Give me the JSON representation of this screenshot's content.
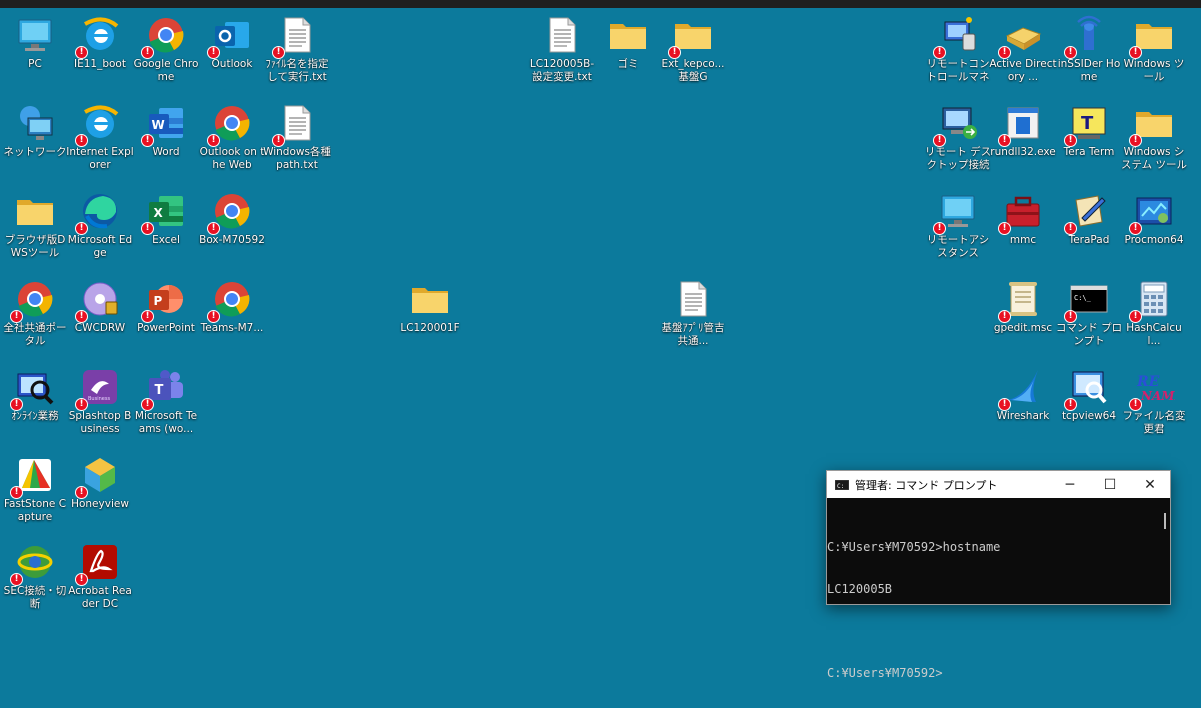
{
  "icons": [
    {
      "label": "PC",
      "kind": "monitor",
      "shortcut": false
    },
    {
      "label": "IE11_boot",
      "kind": "ie",
      "shortcut": true
    },
    {
      "label": "Google Chrome",
      "kind": "chrome",
      "shortcut": true
    },
    {
      "label": "Outlook",
      "kind": "outlook",
      "shortcut": true
    },
    {
      "label": "ﾌｧｲﾙ名を指定して実行.txt",
      "kind": "textfile",
      "shortcut": true
    },
    {
      "label": "LC120005B-設定変更.txt",
      "kind": "textfile",
      "shortcut": false
    },
    {
      "label": "ゴミ",
      "kind": "folder",
      "shortcut": false
    },
    {
      "label": "Ext_kepco...基盤G",
      "kind": "folder",
      "shortcut": true
    },
    {
      "label": "リモートコントロールマネージャ",
      "kind": "remote",
      "shortcut": true
    },
    {
      "label": "Active Directory ...",
      "kind": "book",
      "shortcut": true
    },
    {
      "label": "inSSIDer Home",
      "kind": "antenna",
      "shortcut": true
    },
    {
      "label": "Windows ツール",
      "kind": "folder",
      "shortcut": true
    },
    {
      "label": "ネットワーク",
      "kind": "network",
      "shortcut": false
    },
    {
      "label": "Internet Explorer",
      "kind": "ie",
      "shortcut": true
    },
    {
      "label": "Word",
      "kind": "word",
      "shortcut": true
    },
    {
      "label": "Outlook on the Web",
      "kind": "chrome",
      "shortcut": true
    },
    {
      "label": "Windows各種path.txt",
      "kind": "textfile",
      "shortcut": true
    },
    {
      "label": "リモート デスクトップ接続",
      "kind": "rdp",
      "shortcut": true
    },
    {
      "label": "rundll32.exe",
      "kind": "rundll",
      "shortcut": true
    },
    {
      "label": "Tera Term",
      "kind": "teraterm",
      "shortcut": true
    },
    {
      "label": "Windows システム ツール",
      "kind": "folder",
      "shortcut": true
    },
    {
      "label": "ブラウザ版DWSツール",
      "kind": "folder",
      "shortcut": false
    },
    {
      "label": "Microsoft Edge",
      "kind": "edge",
      "shortcut": true
    },
    {
      "label": "Excel",
      "kind": "excel",
      "shortcut": true
    },
    {
      "label": "Box-M70592",
      "kind": "chrome",
      "shortcut": true
    },
    {
      "label": "リモートアシスタンス",
      "kind": "monitor",
      "shortcut": true
    },
    {
      "label": "mmc",
      "kind": "toolbox",
      "shortcut": true
    },
    {
      "label": "TeraPad",
      "kind": "terapad",
      "shortcut": true
    },
    {
      "label": "Procmon64",
      "kind": "procmon",
      "shortcut": true
    },
    {
      "label": "全社共通ポータル",
      "kind": "chrome",
      "shortcut": true
    },
    {
      "label": "CWCDRW",
      "kind": "disc",
      "shortcut": true
    },
    {
      "label": "PowerPoint",
      "kind": "ppt",
      "shortcut": true
    },
    {
      "label": "Teams-M7...",
      "kind": "chrome",
      "shortcut": true
    },
    {
      "label": "LC120001F",
      "kind": "folder",
      "shortcut": false
    },
    {
      "label": "基盤ｱﾌﾟﾘ管吉　共通...",
      "kind": "textfile",
      "shortcut": false
    },
    {
      "label": "gpedit.msc",
      "kind": "scroll",
      "shortcut": true
    },
    {
      "label": "コマンド プロンプト",
      "kind": "cmd",
      "shortcut": true
    },
    {
      "label": "HashCalcul...",
      "kind": "calc",
      "shortcut": true
    },
    {
      "label": "ｵﾝﾗｲﾝ業務",
      "kind": "online",
      "shortcut": true
    },
    {
      "label": "Splashtop Business",
      "kind": "splashtop",
      "shortcut": true
    },
    {
      "label": "Microsoft Teams (wo...",
      "kind": "teams",
      "shortcut": true
    },
    {
      "label": "Wireshark",
      "kind": "wireshark",
      "shortcut": true
    },
    {
      "label": "tcpview64",
      "kind": "tcpview",
      "shortcut": true
    },
    {
      "label": "ファイル名変更君",
      "kind": "rename",
      "shortcut": true
    },
    {
      "label": "FastStone Capture",
      "kind": "faststone",
      "shortcut": true
    },
    {
      "label": "Honeyview",
      "kind": "honeyview",
      "shortcut": true
    },
    {
      "label": "SEC接続・切断",
      "kind": "globe",
      "shortcut": true
    },
    {
      "label": "Acrobat Reader DC",
      "kind": "acrobat",
      "shortcut": true
    }
  ],
  "cmd": {
    "title": "管理者: コマンド プロンプト",
    "lines": [
      "C:¥Users¥M70592>hostname",
      "LC120005B",
      "",
      "C:¥Users¥M70592>"
    ],
    "minimize": "─",
    "maximize": "☐",
    "close": "✕"
  }
}
